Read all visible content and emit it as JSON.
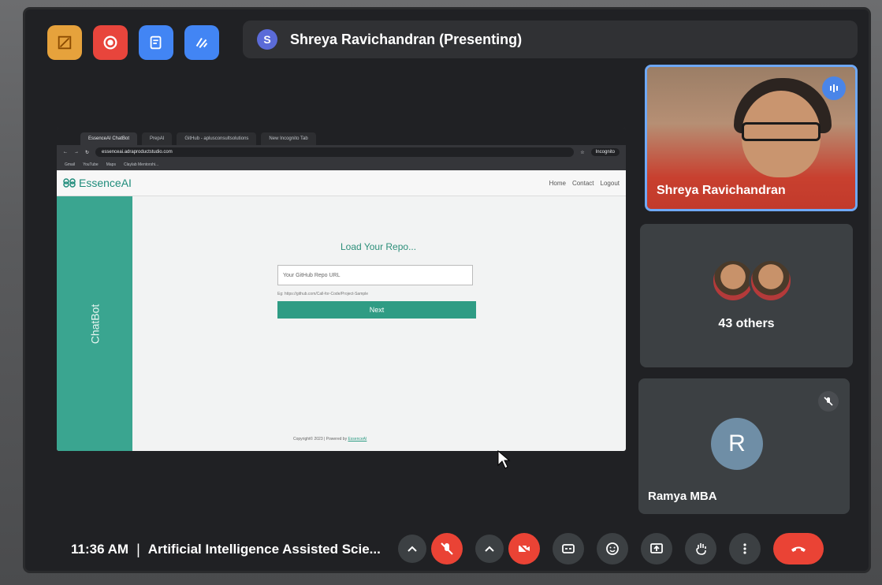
{
  "toolbar": {
    "tools": [
      "highlight-icon",
      "record-icon",
      "notes-icon",
      "activities-icon"
    ],
    "colors": [
      "#e6a23c",
      "#e8453c",
      "#4285f4",
      "#4285f4"
    ]
  },
  "presenter": {
    "initial": "S",
    "label": "Shreya Ravichandran (Presenting)"
  },
  "browser": {
    "tabs": [
      "EssenceAI ChatBot",
      "PrepAI",
      "GitHub - aplusconsultsolutions",
      "New Incognito Tab"
    ],
    "url": "essenceai.adraproductstudio.com",
    "incognito": "Incognito",
    "bookmarks": [
      "Gmail",
      "YouTube",
      "Maps",
      "Claylab Mentorshi..."
    ]
  },
  "app": {
    "logo": "EssenceAI",
    "nav": [
      "Home",
      "Contact",
      "Logout"
    ],
    "sidebar_label": "ChatBot",
    "heading": "Load Your Repo...",
    "input_placeholder": "Your GitHub Repo URL",
    "hint": "Eg: https://github.com/Call-for-Code/Project-Sample",
    "next_label": "Next",
    "footer_prefix": "Copyright© 2023 | Powered by",
    "footer_link": "EssenceAI"
  },
  "participants": {
    "speaker_name": "Shreya Ravichandran",
    "others_label": "43 others",
    "r_initial": "R",
    "r_name": "Ramya MBA"
  },
  "meeting": {
    "time": "11:36 AM",
    "separator": "|",
    "title": "Artificial Intelligence Assisted Scie..."
  }
}
